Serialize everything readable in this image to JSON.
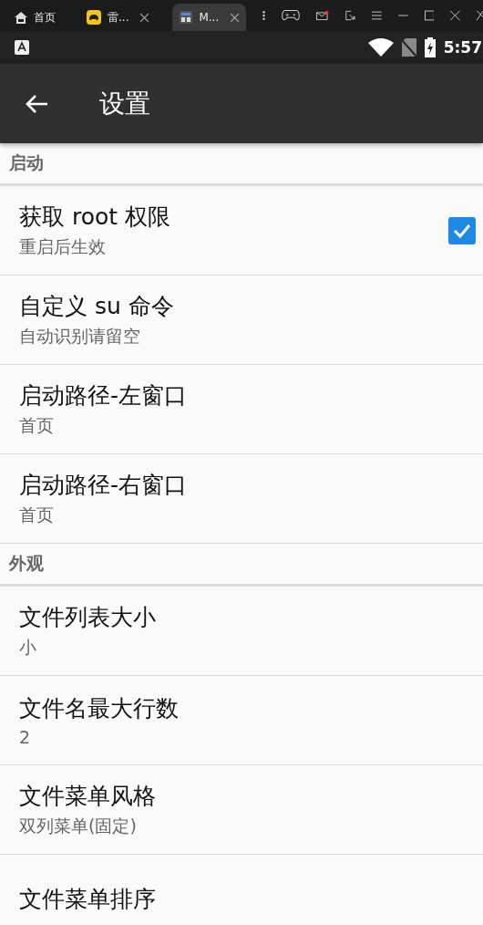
{
  "browser_tabs": [
    {
      "label": "首页",
      "kind": "home",
      "selected": false,
      "closable": false
    },
    {
      "label": "雷...",
      "kind": "game",
      "selected": false,
      "closable": true
    },
    {
      "label": "M...",
      "kind": "app",
      "selected": true,
      "closable": true
    }
  ],
  "toolbar": {
    "mail_unread": true
  },
  "status_bar": {
    "time": "5:57"
  },
  "app_bar": {
    "title": "设置"
  },
  "sections": [
    {
      "title": "启动",
      "items": [
        {
          "kind": "checkbox",
          "title": "获取 root 权限",
          "subtitle": "重启后生效",
          "checked": true
        },
        {
          "kind": "text",
          "title": "自定义 su 命令",
          "subtitle": "自动识别请留空"
        },
        {
          "kind": "text",
          "title": "启动路径-左窗口",
          "subtitle": "首页"
        },
        {
          "kind": "text",
          "title": "启动路径-右窗口",
          "subtitle": "首页"
        }
      ]
    },
    {
      "title": "外观",
      "items": [
        {
          "kind": "text",
          "title": "文件列表大小",
          "subtitle": "小"
        },
        {
          "kind": "text",
          "title": "文件名最大行数",
          "subtitle": "2"
        },
        {
          "kind": "text",
          "title": "文件菜单风格",
          "subtitle": "双列菜单(固定)"
        },
        {
          "kind": "text",
          "title": "文件菜单排序"
        }
      ]
    }
  ]
}
